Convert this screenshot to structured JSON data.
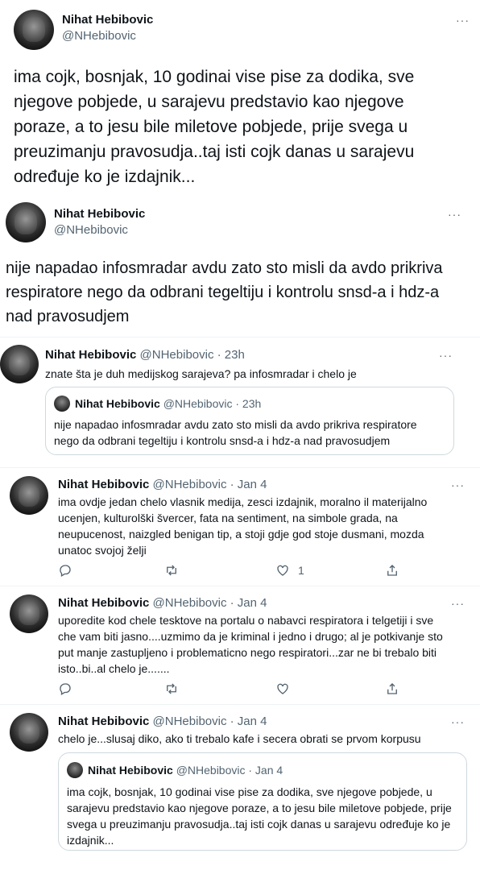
{
  "tweet1": {
    "name": "Nihat Hebibovic",
    "handle": "@NHebibovic",
    "more": "···",
    "text": "ima cojk, bosnjak, 10 godinai vise pise za dodika, sve njegove pobjede, u sarajevu predstavio kao njegove poraze, a to jesu bile miletove pobjede, prije svega u preuzimanju pravosudja..taj isti cojk danas u sarajevu određuje ko je izdajnik..."
  },
  "tweet2": {
    "name": "Nihat Hebibovic",
    "handle": "@NHebibovic",
    "more": "···",
    "text": "nije napadao infosmradar avdu zato sto misli da avdo prikriva respiratore nego da odbrani tegeltiju i kontrolu snsd-a i hdz-a nad pravosudjem"
  },
  "tweet3": {
    "name": "Nihat Hebibovic",
    "meta": "@NHebibovic · 23h",
    "more": "···",
    "text": "znate šta je duh medijskog sarajeva? pa infosmradar i chelo je",
    "quote": {
      "name": "Nihat Hebibovic",
      "meta": "@NHebibovic · 23h",
      "text": "nije napadao infosmradar avdu zato sto misli da avdo prikriva respiratore nego da odbrani tegeltiju i kontrolu snsd-a i hdz-a nad pravosudjem"
    }
  },
  "tweet4": {
    "name": "Nihat Hebibovic",
    "meta": "@NHebibovic · Jan 4",
    "more": "···",
    "text": "ima ovdje jedan chelo vlasnik medija, zesci izdajnik, moralno il materijalno ucenjen, kulturolški švercer, fata na sentiment, na simbole grada, na neupucenost, naizgled benigan tip, a stoji gdje god stoje dusmani, mozda unatoc svojoj želji",
    "likes": "1"
  },
  "tweet5": {
    "name": "Nihat Hebibovic",
    "meta": "@NHebibovic · Jan 4",
    "more": "···",
    "text": "uporedite kod chele tesktove na portalu o nabavci respiratora i telgetiji i sve che vam biti jasno....uzmimo da je kriminal i jedno i drugo; al je potkivanje sto put manje zastupljeno i problematicno nego respiratori...zar ne bi trebalo biti isto..bi..al chelo je......."
  },
  "tweet6": {
    "name": "Nihat Hebibovic",
    "meta": "@NHebibovic · Jan 4",
    "more": "···",
    "text": "chelo je...slusaj diko, ako ti trebalo kafe i secera obrati se prvom korpusu",
    "quote": {
      "name": "Nihat Hebibovic",
      "meta": "@NHebibovic · Jan 4",
      "text": "ima cojk, bosnjak, 10 godinai vise pise za dodika, sve njegove pobjede, u sarajevu predstavio kao njegove poraze, a to jesu bile miletove pobjede, prije svega u preuzimanju pravosudja..taj isti cojk danas u sarajevu određuje ko je izdajnik..."
    }
  },
  "icons": {
    "reply": "reply-icon",
    "retweet": "retweet-icon",
    "like": "heart-icon",
    "share": "share-icon",
    "more": "more-icon"
  },
  "colors": {
    "text": "#0f1419",
    "secondary": "#536471",
    "border": "#cfd9de"
  }
}
